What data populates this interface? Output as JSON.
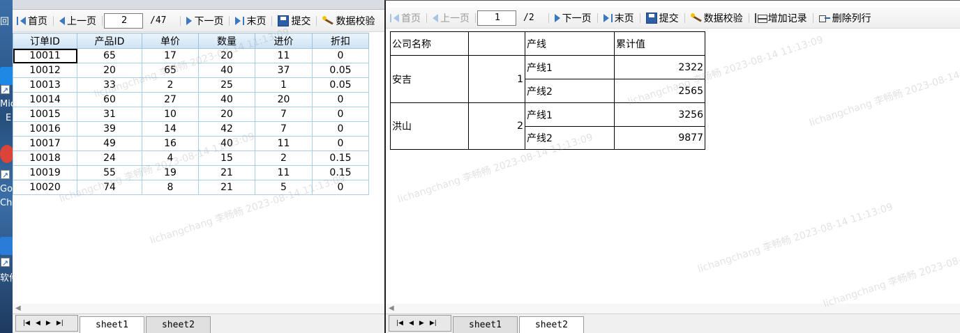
{
  "desktop": {
    "labels": [
      "回",
      "Mic",
      "E",
      "Go",
      "Ch",
      "软件"
    ]
  },
  "watermark": "lichangchang 李畅畅 2023-08-14 11:13:09",
  "left_window": {
    "toolbar": {
      "first": "首页",
      "prev": "上一页",
      "page": "2",
      "total": "/47",
      "next": "下一页",
      "last": "末页",
      "submit": "提交",
      "validate": "数据校验"
    },
    "table": {
      "headers": [
        "订单ID",
        "产品ID",
        "单价",
        "数量",
        "进价",
        "折扣"
      ],
      "rows": [
        [
          "10011",
          "65",
          "17",
          "20",
          "11",
          "0"
        ],
        [
          "10012",
          "20",
          "65",
          "40",
          "37",
          "0.05"
        ],
        [
          "10013",
          "33",
          "2",
          "25",
          "1",
          "0.05"
        ],
        [
          "10014",
          "60",
          "27",
          "40",
          "20",
          "0"
        ],
        [
          "10015",
          "31",
          "10",
          "20",
          "7",
          "0"
        ],
        [
          "10016",
          "39",
          "14",
          "42",
          "7",
          "0"
        ],
        [
          "10017",
          "49",
          "16",
          "40",
          "11",
          "0"
        ],
        [
          "10018",
          "24",
          "4",
          "15",
          "2",
          "0.15"
        ],
        [
          "10019",
          "55",
          "19",
          "21",
          "11",
          "0.15"
        ],
        [
          "10020",
          "74",
          "8",
          "21",
          "5",
          "0"
        ]
      ]
    },
    "tabs": [
      "sheet1",
      "sheet2"
    ]
  },
  "right_window": {
    "toolbar": {
      "first": "首页",
      "prev": "上一页",
      "page": "1",
      "total": "/2",
      "next": "下一页",
      "last": "末页",
      "submit": "提交",
      "validate": "数据校验",
      "add_record": "增加记录",
      "delete_row": "删除列行"
    },
    "table": {
      "h_company": "公司名称",
      "h_blank": "",
      "h_line": "产线",
      "h_total": "累计值",
      "groups": [
        {
          "company": "安吉",
          "index": "1",
          "lines": [
            {
              "name": "产线1",
              "value": "2322"
            },
            {
              "name": "产线2",
              "value": "2565"
            }
          ]
        },
        {
          "company": "洪山",
          "index": "2",
          "lines": [
            {
              "name": "产线1",
              "value": "3256"
            },
            {
              "name": "产线2",
              "value": "9877"
            }
          ]
        }
      ]
    },
    "tabs": [
      "sheet1",
      "sheet2"
    ]
  }
}
